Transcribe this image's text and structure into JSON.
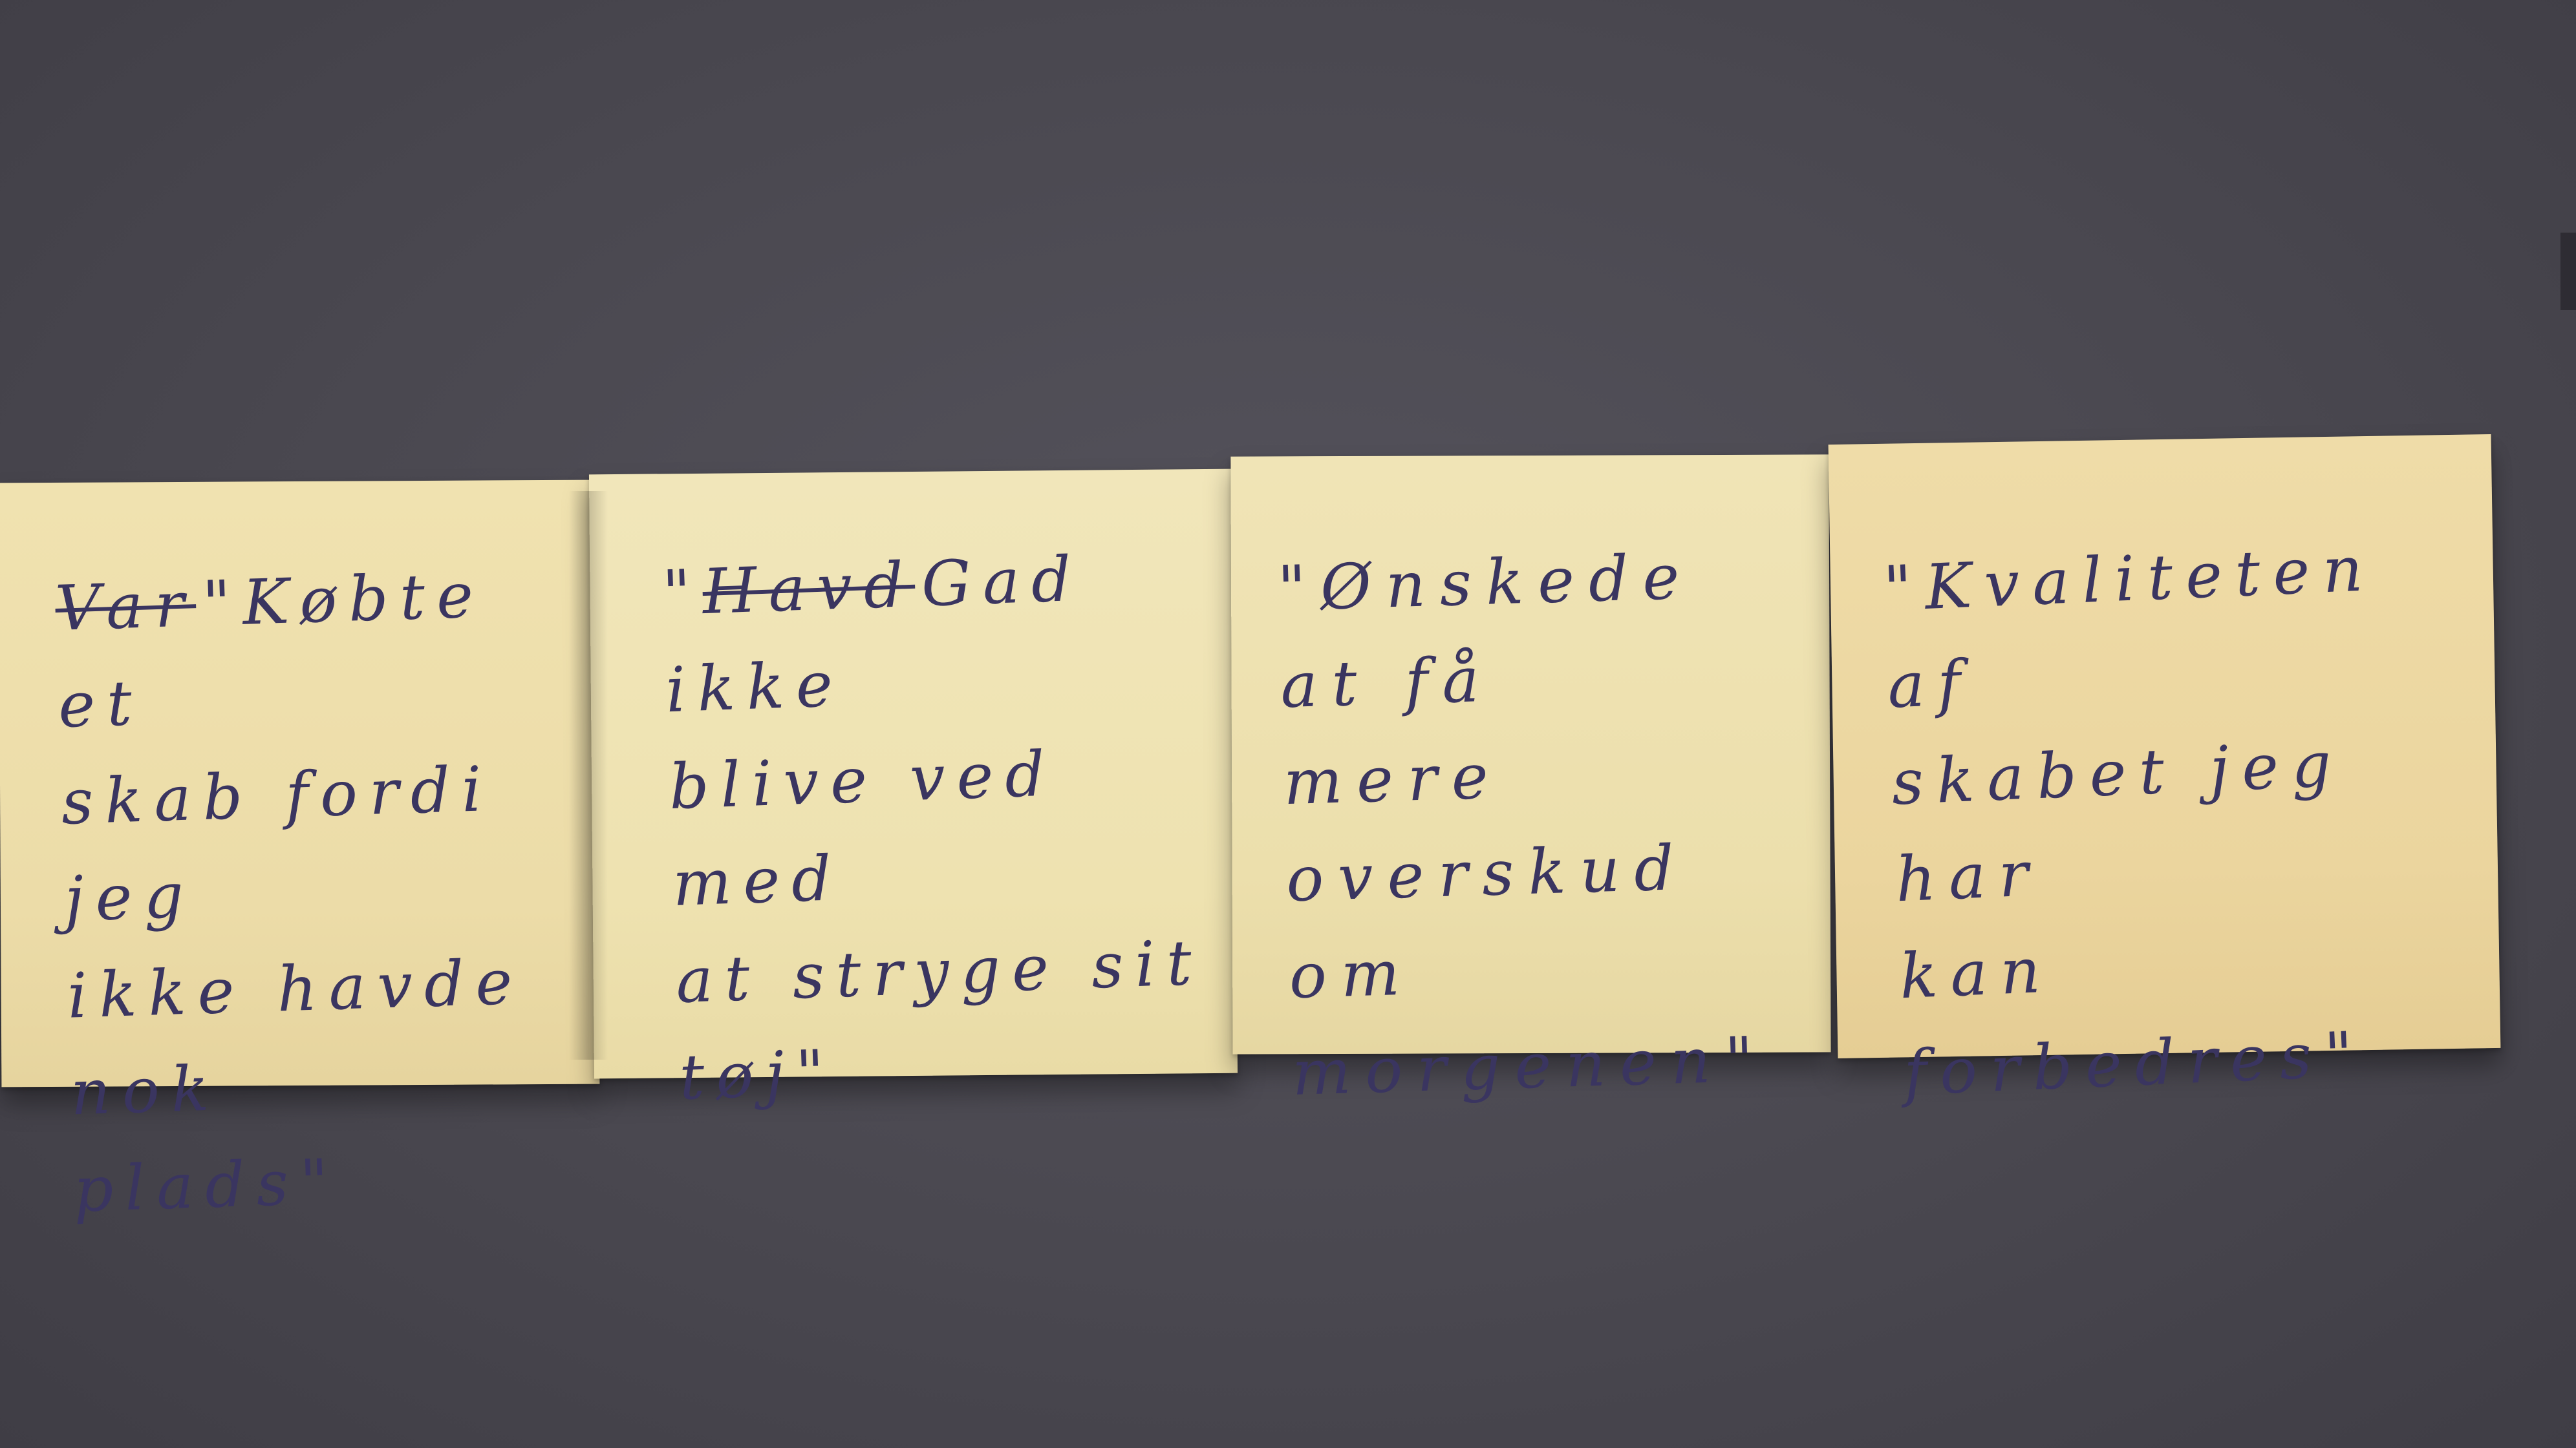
{
  "notes": [
    {
      "crossed_out": "Var",
      "text": "\"Købte et\nskab fordi jeg\nikke havde nok\nplads\""
    },
    {
      "crossed_out": "Havd",
      "text": "Gad ikke\nblive ved med\nat stryge sit\ntøj\""
    },
    {
      "crossed_out": "",
      "text": "\"Ønskede at få\nmere overskud\nom morgenen\""
    },
    {
      "crossed_out": "",
      "text": "\"Kvaliteten af\nskabet jeg har\nkan forbedres\""
    }
  ],
  "colors": {
    "surface": "#4a4850",
    "sticky_note": "#efe1b0",
    "ink": "#3a3560"
  }
}
